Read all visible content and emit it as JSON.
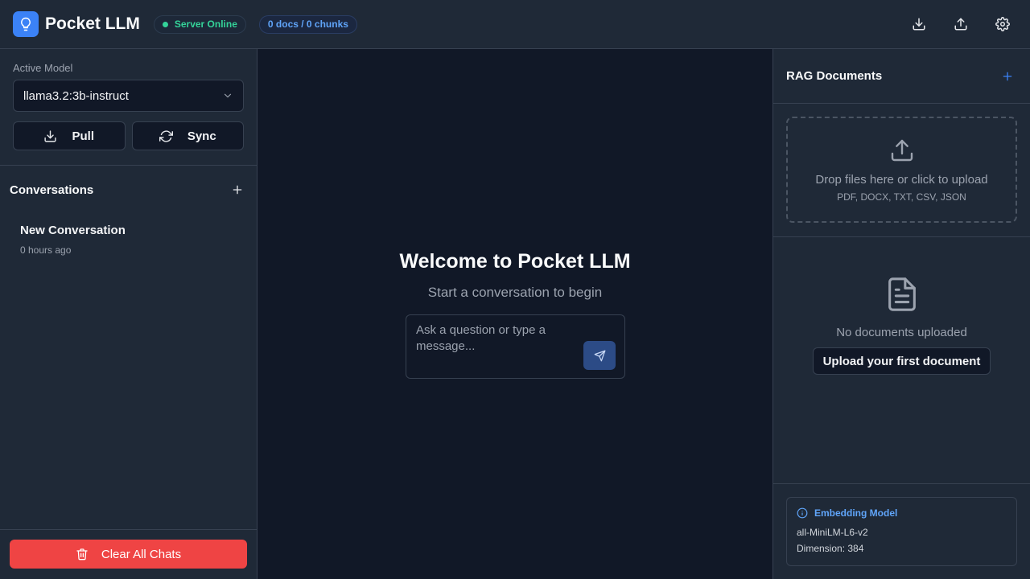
{
  "app": {
    "title": "Pocket LLM",
    "status_label": "Server Online",
    "docs_label": "0 docs / 0 chunks",
    "accent_color": "#3b82f6",
    "status_color": "#34d399"
  },
  "header": {
    "actions": [
      "download-icon",
      "upload-icon",
      "gear-icon"
    ]
  },
  "sidebar": {
    "model_label": "Active Model",
    "selected_model": "llama3.2:3b-instruct",
    "pull_label": "Pull",
    "sync_label": "Sync",
    "conversations_title": "Conversations",
    "conversations": [
      {
        "title": "New Conversation",
        "time": "0 hours ago"
      }
    ],
    "clear_label": "Clear All Chats",
    "clear_color": "#ef4444"
  },
  "main": {
    "welcome_title": "Welcome to Pocket LLM",
    "welcome_subtitle": "Start a conversation to begin",
    "input_placeholder": "Ask a question or type a message..."
  },
  "rag": {
    "title": "RAG Documents",
    "dropzone_text": "Drop files here or click to upload",
    "dropzone_types": "PDF, DOCX, TXT, CSV, JSON",
    "empty_text": "No documents uploaded",
    "upload_first_label": "Upload your first document",
    "embedding_title": "Embedding Model",
    "embedding_model": "all-MiniLM-L6-v2",
    "embedding_dimension": "Dimension: 384"
  }
}
